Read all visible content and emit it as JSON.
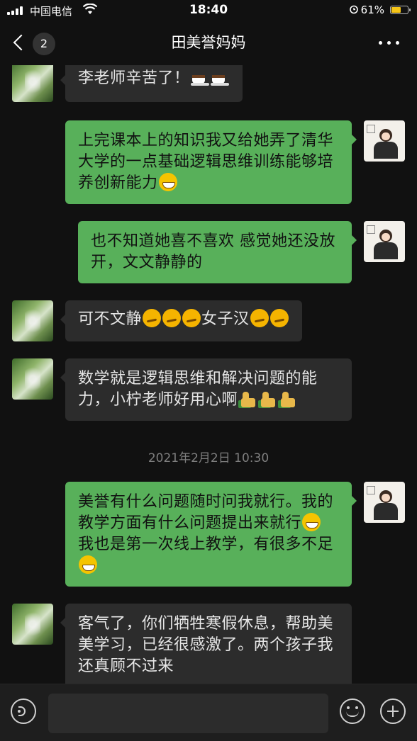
{
  "status_bar": {
    "carrier": "中国电信",
    "time": "18:40",
    "battery_percent": "61%",
    "battery_level": 0.61,
    "icons": [
      "signal-icon",
      "wifi-icon",
      "alarm-icon",
      "battery-icon"
    ]
  },
  "nav": {
    "title": "田美誉妈妈",
    "unread_count": "2",
    "back_icon": "chevron-left-icon",
    "more_icon": "ellipsis-icon"
  },
  "messages": [
    {
      "sender": "other",
      "text": "李老师辛苦了！",
      "emojis": [
        "coffee",
        "coffee"
      ]
    },
    {
      "sender": "self",
      "text": "上完课本上的知识我又给她弄了清华大学的一点基础逻辑思维训练能够培养创新能力",
      "emojis": [
        "grin"
      ]
    },
    {
      "sender": "self",
      "text": "也不知道她喜不喜欢 感觉她还没放开，文文静静的",
      "emojis": []
    },
    {
      "sender": "other",
      "text_before": "可不文静",
      "text_after": "女子汉",
      "emojis_before": [
        "thinking",
        "thinking",
        "thinking"
      ],
      "emojis_after": [
        "thinking",
        "thinking"
      ]
    },
    {
      "sender": "other",
      "text": "数学就是逻辑思维和解决问题的能力，小柠老师好用心啊",
      "emojis": [
        "thumb",
        "thumb",
        "thumb"
      ]
    },
    {
      "sender": "self",
      "text_part1": "美誉有什么问题随时问我就行。我的教学方面有什么问题提出来就行",
      "text_part2": " 我也是第一次线上教学，有很多不足",
      "emojis_mid": [
        "grin"
      ],
      "emojis_after": [
        "grin"
      ]
    },
    {
      "sender": "other",
      "text": "客气了，你们牺牲寒假休息，帮助美美学习，已经很感激了。两个孩子我还真顾不过来",
      "emojis": []
    }
  ],
  "timestamp": "2021年2月2日 10:30",
  "input_bar": {
    "placeholder": "",
    "icons": [
      "voice-icon",
      "emoji-icon",
      "plus-icon"
    ]
  },
  "colors": {
    "background": "#111111",
    "self_bubble": "#58b05a",
    "other_bubble": "#2c2c2c",
    "battery": "#f5c518"
  }
}
